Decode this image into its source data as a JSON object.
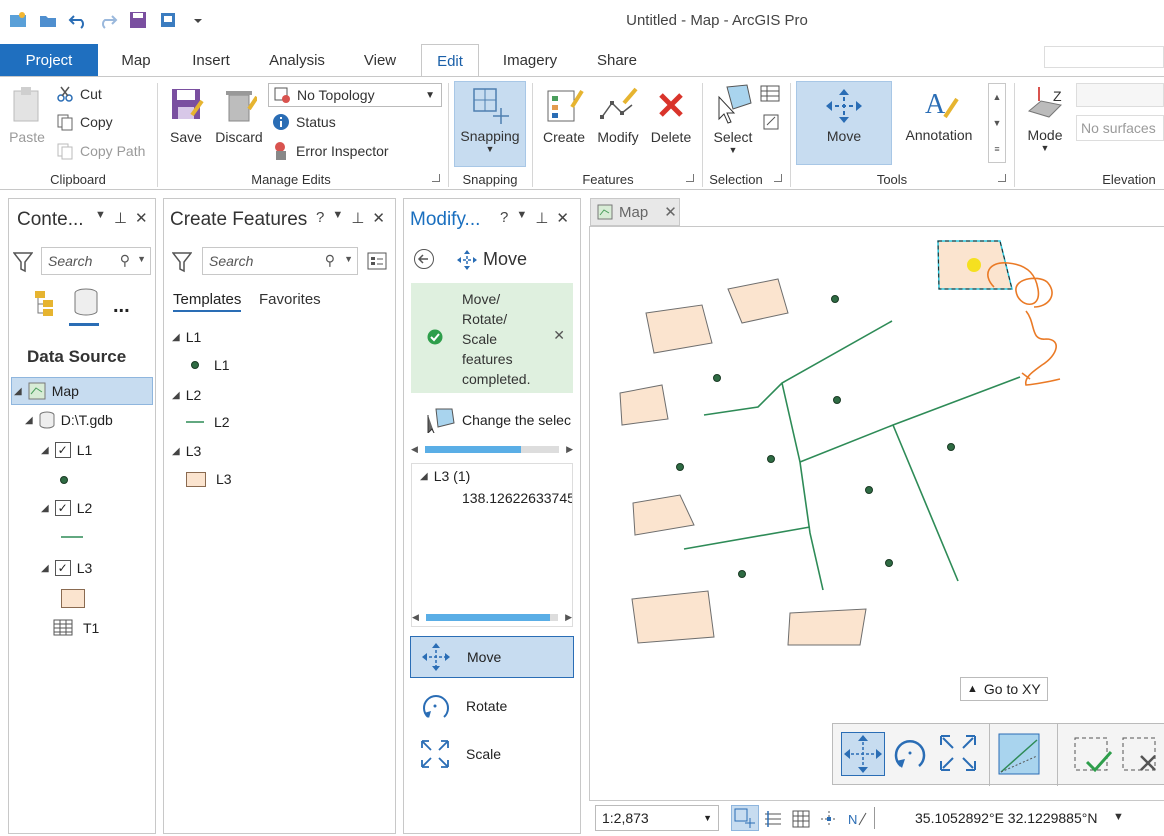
{
  "window": {
    "title": "Untitled - Map - ArcGIS Pro"
  },
  "tabs": [
    "Project",
    "Map",
    "Insert",
    "Analysis",
    "View",
    "Edit",
    "Imagery",
    "Share"
  ],
  "ribbon": {
    "clipboard": {
      "paste": "Paste",
      "cut": "Cut",
      "copy": "Copy",
      "copy_path": "Copy Path",
      "label": "Clipboard"
    },
    "manage_edits": {
      "save": "Save",
      "discard": "Discard",
      "topology": "No Topology",
      "status": "Status",
      "error_inspector": "Error Inspector",
      "label": "Manage Edits"
    },
    "snapping": {
      "button": "Snapping",
      "label": "Snapping"
    },
    "features": {
      "create": "Create",
      "modify": "Modify",
      "delete": "Delete",
      "label": "Features"
    },
    "selection": {
      "select": "Select",
      "label": "Selection"
    },
    "tools": {
      "move": "Move",
      "annotation": "Annotation",
      "label": "Tools"
    },
    "elevation": {
      "mode": "Mode",
      "surfaces": "No surfaces",
      "label": "Elevation"
    }
  },
  "contents_pane": {
    "title": "Conte...",
    "search_placeholder": "Search",
    "more": "...",
    "heading": "Data Source",
    "map": "Map",
    "gdb": "D:\\T.gdb",
    "layers": [
      "L1",
      "L2",
      "L3"
    ],
    "table": "T1"
  },
  "create_features_pane": {
    "title": "Create Features",
    "search_placeholder": "Search",
    "tab_templates": "Templates",
    "tab_favorites": "Favorites",
    "groups": [
      {
        "header": "L1",
        "item": "L1"
      },
      {
        "header": "L2",
        "item": "L2"
      },
      {
        "header": "L3",
        "item": "L3"
      }
    ]
  },
  "modify_pane": {
    "title": "Modify...",
    "tool": "Move",
    "message": [
      "Move/",
      "Rotate/",
      "Scale",
      "features",
      "completed."
    ],
    "change_selection": "Change the selec",
    "layer": "L3 (1)",
    "feature_value": "138.12622633745",
    "options": [
      "Move",
      "Rotate",
      "Scale"
    ]
  },
  "map": {
    "tab": "Map",
    "go_to_xy": "Go to XY",
    "scale": "1:2,873",
    "coordinates": "35.1052892°E 32.1229885°N"
  },
  "colors": {
    "accent": "#1f6fbf",
    "polygon_fill": "#fbe4cf",
    "line": "#2e8b57",
    "sketch": "#ea7a26"
  }
}
